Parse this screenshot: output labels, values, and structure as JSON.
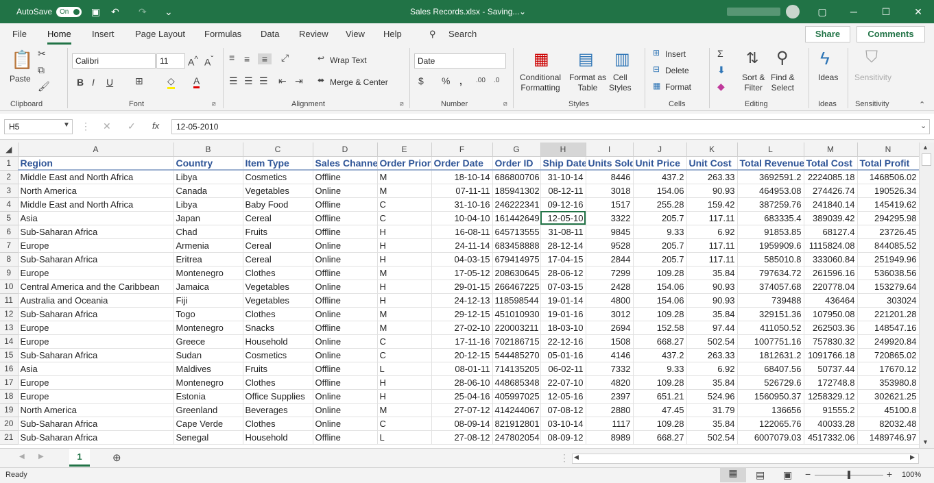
{
  "titlebar": {
    "autosave_label": "AutoSave",
    "autosave_state": "On",
    "title": "Sales Records.xlsx  -  Saving...",
    "title_caret": "⌄"
  },
  "menu": {
    "tabs": [
      "File",
      "Home",
      "Insert",
      "Page Layout",
      "Formulas",
      "Data",
      "Review",
      "View",
      "Help"
    ],
    "active_tab": "Home",
    "search_label": "Search",
    "share_label": "Share",
    "comments_label": "Comments"
  },
  "ribbon": {
    "clipboard": {
      "paste_label": "Paste",
      "group_label": "Clipboard"
    },
    "font": {
      "font_name": "Calibri",
      "font_size": "11",
      "group_label": "Font"
    },
    "alignment": {
      "wrap_text_label": "Wrap Text",
      "merge_label": "Merge & Center",
      "group_label": "Alignment"
    },
    "number": {
      "format_value": "Date",
      "group_label": "Number"
    },
    "styles": {
      "conditional_line1": "Conditional",
      "conditional_line2": "Formatting",
      "format_table_line1": "Format as",
      "format_table_line2": "Table",
      "cell_styles_line1": "Cell",
      "cell_styles_line2": "Styles",
      "group_label": "Styles"
    },
    "cells": {
      "insert_label": "Insert",
      "delete_label": "Delete",
      "format_label": "Format",
      "group_label": "Cells"
    },
    "editing": {
      "sort_line1": "Sort &",
      "sort_line2": "Filter",
      "find_line1": "Find &",
      "find_line2": "Select",
      "group_label": "Editing"
    },
    "ideas": {
      "label": "Ideas",
      "group_label": "Ideas"
    },
    "sensitivity": {
      "label": "Sensitivity",
      "group_label": "Sensitivity"
    }
  },
  "formula_bar": {
    "name_box": "H5",
    "fx": "fx",
    "content": "12-05-2010"
  },
  "columns": [
    "A",
    "B",
    "C",
    "D",
    "E",
    "F",
    "G",
    "H",
    "I",
    "J",
    "K",
    "L",
    "M",
    "N"
  ],
  "headers": [
    "Region",
    "Country",
    "Item Type",
    "Sales Channel",
    "Order Priority",
    "Order Date",
    "Order ID",
    "Ship Date",
    "Units Sold",
    "Unit Price",
    "Unit Cost",
    "Total Revenue",
    "Total Cost",
    "Total Profit"
  ],
  "rows": [
    [
      "Middle East and North Africa",
      "Libya",
      "Cosmetics",
      "Offline",
      "M",
      "18-10-14",
      "686800706",
      "31-10-14",
      "8446",
      "437.2",
      "263.33",
      "3692591.2",
      "2224085.18",
      "1468506.02"
    ],
    [
      "North America",
      "Canada",
      "Vegetables",
      "Online",
      "M",
      "07-11-11",
      "185941302",
      "08-12-11",
      "3018",
      "154.06",
      "90.93",
      "464953.08",
      "274426.74",
      "190526.34"
    ],
    [
      "Middle East and North Africa",
      "Libya",
      "Baby Food",
      "Offline",
      "C",
      "31-10-16",
      "246222341",
      "09-12-16",
      "1517",
      "255.28",
      "159.42",
      "387259.76",
      "241840.14",
      "145419.62"
    ],
    [
      "Asia",
      "Japan",
      "Cereal",
      "Offline",
      "C",
      "10-04-10",
      "161442649",
      "12-05-10",
      "3322",
      "205.7",
      "117.11",
      "683335.4",
      "389039.42",
      "294295.98"
    ],
    [
      "Sub-Saharan Africa",
      "Chad",
      "Fruits",
      "Offline",
      "H",
      "16-08-11",
      "645713555",
      "31-08-11",
      "9845",
      "9.33",
      "6.92",
      "91853.85",
      "68127.4",
      "23726.45"
    ],
    [
      "Europe",
      "Armenia",
      "Cereal",
      "Online",
      "H",
      "24-11-14",
      "683458888",
      "28-12-14",
      "9528",
      "205.7",
      "117.11",
      "1959909.6",
      "1115824.08",
      "844085.52"
    ],
    [
      "Sub-Saharan Africa",
      "Eritrea",
      "Cereal",
      "Online",
      "H",
      "04-03-15",
      "679414975",
      "17-04-15",
      "2844",
      "205.7",
      "117.11",
      "585010.8",
      "333060.84",
      "251949.96"
    ],
    [
      "Europe",
      "Montenegro",
      "Clothes",
      "Offline",
      "M",
      "17-05-12",
      "208630645",
      "28-06-12",
      "7299",
      "109.28",
      "35.84",
      "797634.72",
      "261596.16",
      "536038.56"
    ],
    [
      "Central America and the Caribbean",
      "Jamaica",
      "Vegetables",
      "Online",
      "H",
      "29-01-15",
      "266467225",
      "07-03-15",
      "2428",
      "154.06",
      "90.93",
      "374057.68",
      "220778.04",
      "153279.64"
    ],
    [
      "Australia and Oceania",
      "Fiji",
      "Vegetables",
      "Offline",
      "H",
      "24-12-13",
      "118598544",
      "19-01-14",
      "4800",
      "154.06",
      "90.93",
      "739488",
      "436464",
      "303024"
    ],
    [
      "Sub-Saharan Africa",
      "Togo",
      "Clothes",
      "Online",
      "M",
      "29-12-15",
      "451010930",
      "19-01-16",
      "3012",
      "109.28",
      "35.84",
      "329151.36",
      "107950.08",
      "221201.28"
    ],
    [
      "Europe",
      "Montenegro",
      "Snacks",
      "Offline",
      "M",
      "27-02-10",
      "220003211",
      "18-03-10",
      "2694",
      "152.58",
      "97.44",
      "411050.52",
      "262503.36",
      "148547.16"
    ],
    [
      "Europe",
      "Greece",
      "Household",
      "Online",
      "C",
      "17-11-16",
      "702186715",
      "22-12-16",
      "1508",
      "668.27",
      "502.54",
      "1007751.16",
      "757830.32",
      "249920.84"
    ],
    [
      "Sub-Saharan Africa",
      "Sudan",
      "Cosmetics",
      "Online",
      "C",
      "20-12-15",
      "544485270",
      "05-01-16",
      "4146",
      "437.2",
      "263.33",
      "1812631.2",
      "1091766.18",
      "720865.02"
    ],
    [
      "Asia",
      "Maldives",
      "Fruits",
      "Offline",
      "L",
      "08-01-11",
      "714135205",
      "06-02-11",
      "7332",
      "9.33",
      "6.92",
      "68407.56",
      "50737.44",
      "17670.12"
    ],
    [
      "Europe",
      "Montenegro",
      "Clothes",
      "Offline",
      "H",
      "28-06-10",
      "448685348",
      "22-07-10",
      "4820",
      "109.28",
      "35.84",
      "526729.6",
      "172748.8",
      "353980.8"
    ],
    [
      "Europe",
      "Estonia",
      "Office Supplies",
      "Online",
      "H",
      "25-04-16",
      "405997025",
      "12-05-16",
      "2397",
      "651.21",
      "524.96",
      "1560950.37",
      "1258329.12",
      "302621.25"
    ],
    [
      "North America",
      "Greenland",
      "Beverages",
      "Online",
      "M",
      "27-07-12",
      "414244067",
      "07-08-12",
      "2880",
      "47.45",
      "31.79",
      "136656",
      "91555.2",
      "45100.8"
    ],
    [
      "Sub-Saharan Africa",
      "Cape Verde",
      "Clothes",
      "Online",
      "C",
      "08-09-14",
      "821912801",
      "03-10-14",
      "1117",
      "109.28",
      "35.84",
      "122065.76",
      "40033.28",
      "82032.48"
    ],
    [
      "Sub-Saharan Africa",
      "Senegal",
      "Household",
      "Offline",
      "L",
      "27-08-12",
      "247802054",
      "08-09-12",
      "8989",
      "668.27",
      "502.54",
      "6007079.03",
      "4517332.06",
      "1489746.97"
    ]
  ],
  "sheet": {
    "tab_label": "1"
  },
  "status": {
    "ready": "Ready",
    "zoom": "100%"
  }
}
